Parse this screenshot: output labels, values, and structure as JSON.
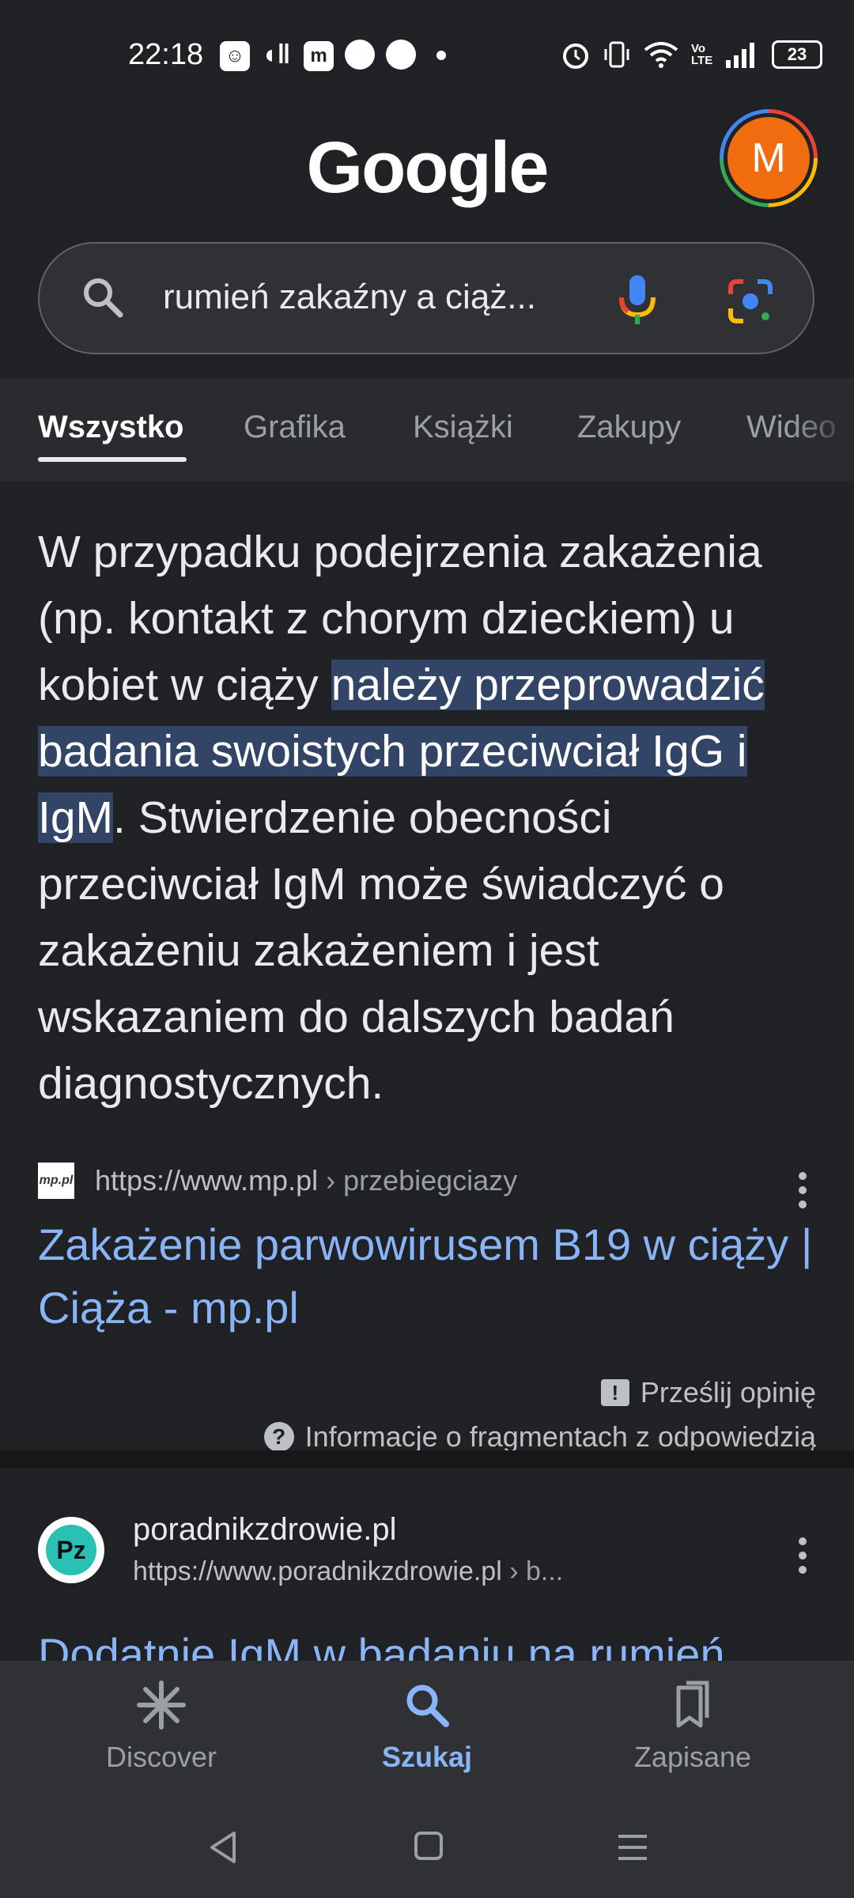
{
  "status_bar": {
    "time": "22:18",
    "notification_icons": [
      "messenger-face-icon",
      "audio-icon",
      "m-app-icon",
      "messenger-icon",
      "app-icon",
      "dot-icon"
    ],
    "right_icons": [
      "alarm-icon",
      "vibrate-icon",
      "wifi-icon",
      "volte-icon",
      "signal-icon"
    ],
    "volte_label": "Vo\nLTE",
    "battery": "23"
  },
  "header": {
    "logo_text": "Google",
    "avatar_letter": "M"
  },
  "search": {
    "query": "rumień zakaźny a ciąż..."
  },
  "tabs": [
    {
      "label": "Wszystko",
      "active": true
    },
    {
      "label": "Grafika"
    },
    {
      "label": "Książki"
    },
    {
      "label": "Zakupy"
    },
    {
      "label": "Wideo"
    }
  ],
  "snippet": {
    "text_before": "W przypadku podejrzenia zakażenia (np. kontakt z chorym dzieckiem) u kobiet w ciąży ",
    "text_highlight": "należy przeprowadzić badania swoistych przeciwciał IgG i IgM",
    "text_after": ". Stwierdzenie obecności przeciwciał IgM może świadczyć o zakażeniu zakażeniem i jest wskazaniem do dalszych badań diagnostycznych.",
    "favicon_text": "mp.pl",
    "url": "https://www.mp.pl",
    "breadcrumb": " › przebiegciazy",
    "title": "Zakażenie parwowirusem B19 w ciąży | Ciąża - mp.pl",
    "feedback": "Prześlij opinię",
    "info": "Informacje o fragmentach z odpowiedzią"
  },
  "result2": {
    "favicon_text": "Pz",
    "site": "poradnikzdrowie.pl",
    "url": "https://www.poradnikzdrowie.pl",
    "breadcrumb": " › b...",
    "title": "Dodatnie IgM w badaniu na rumień"
  },
  "bottom_nav": {
    "discover": "Discover",
    "search": "Szukaj",
    "saved": "Zapisane"
  },
  "colors": {
    "background": "#202124",
    "link": "#8ab4f8",
    "highlight": "#334566",
    "avatar": "#f06d0f"
  }
}
